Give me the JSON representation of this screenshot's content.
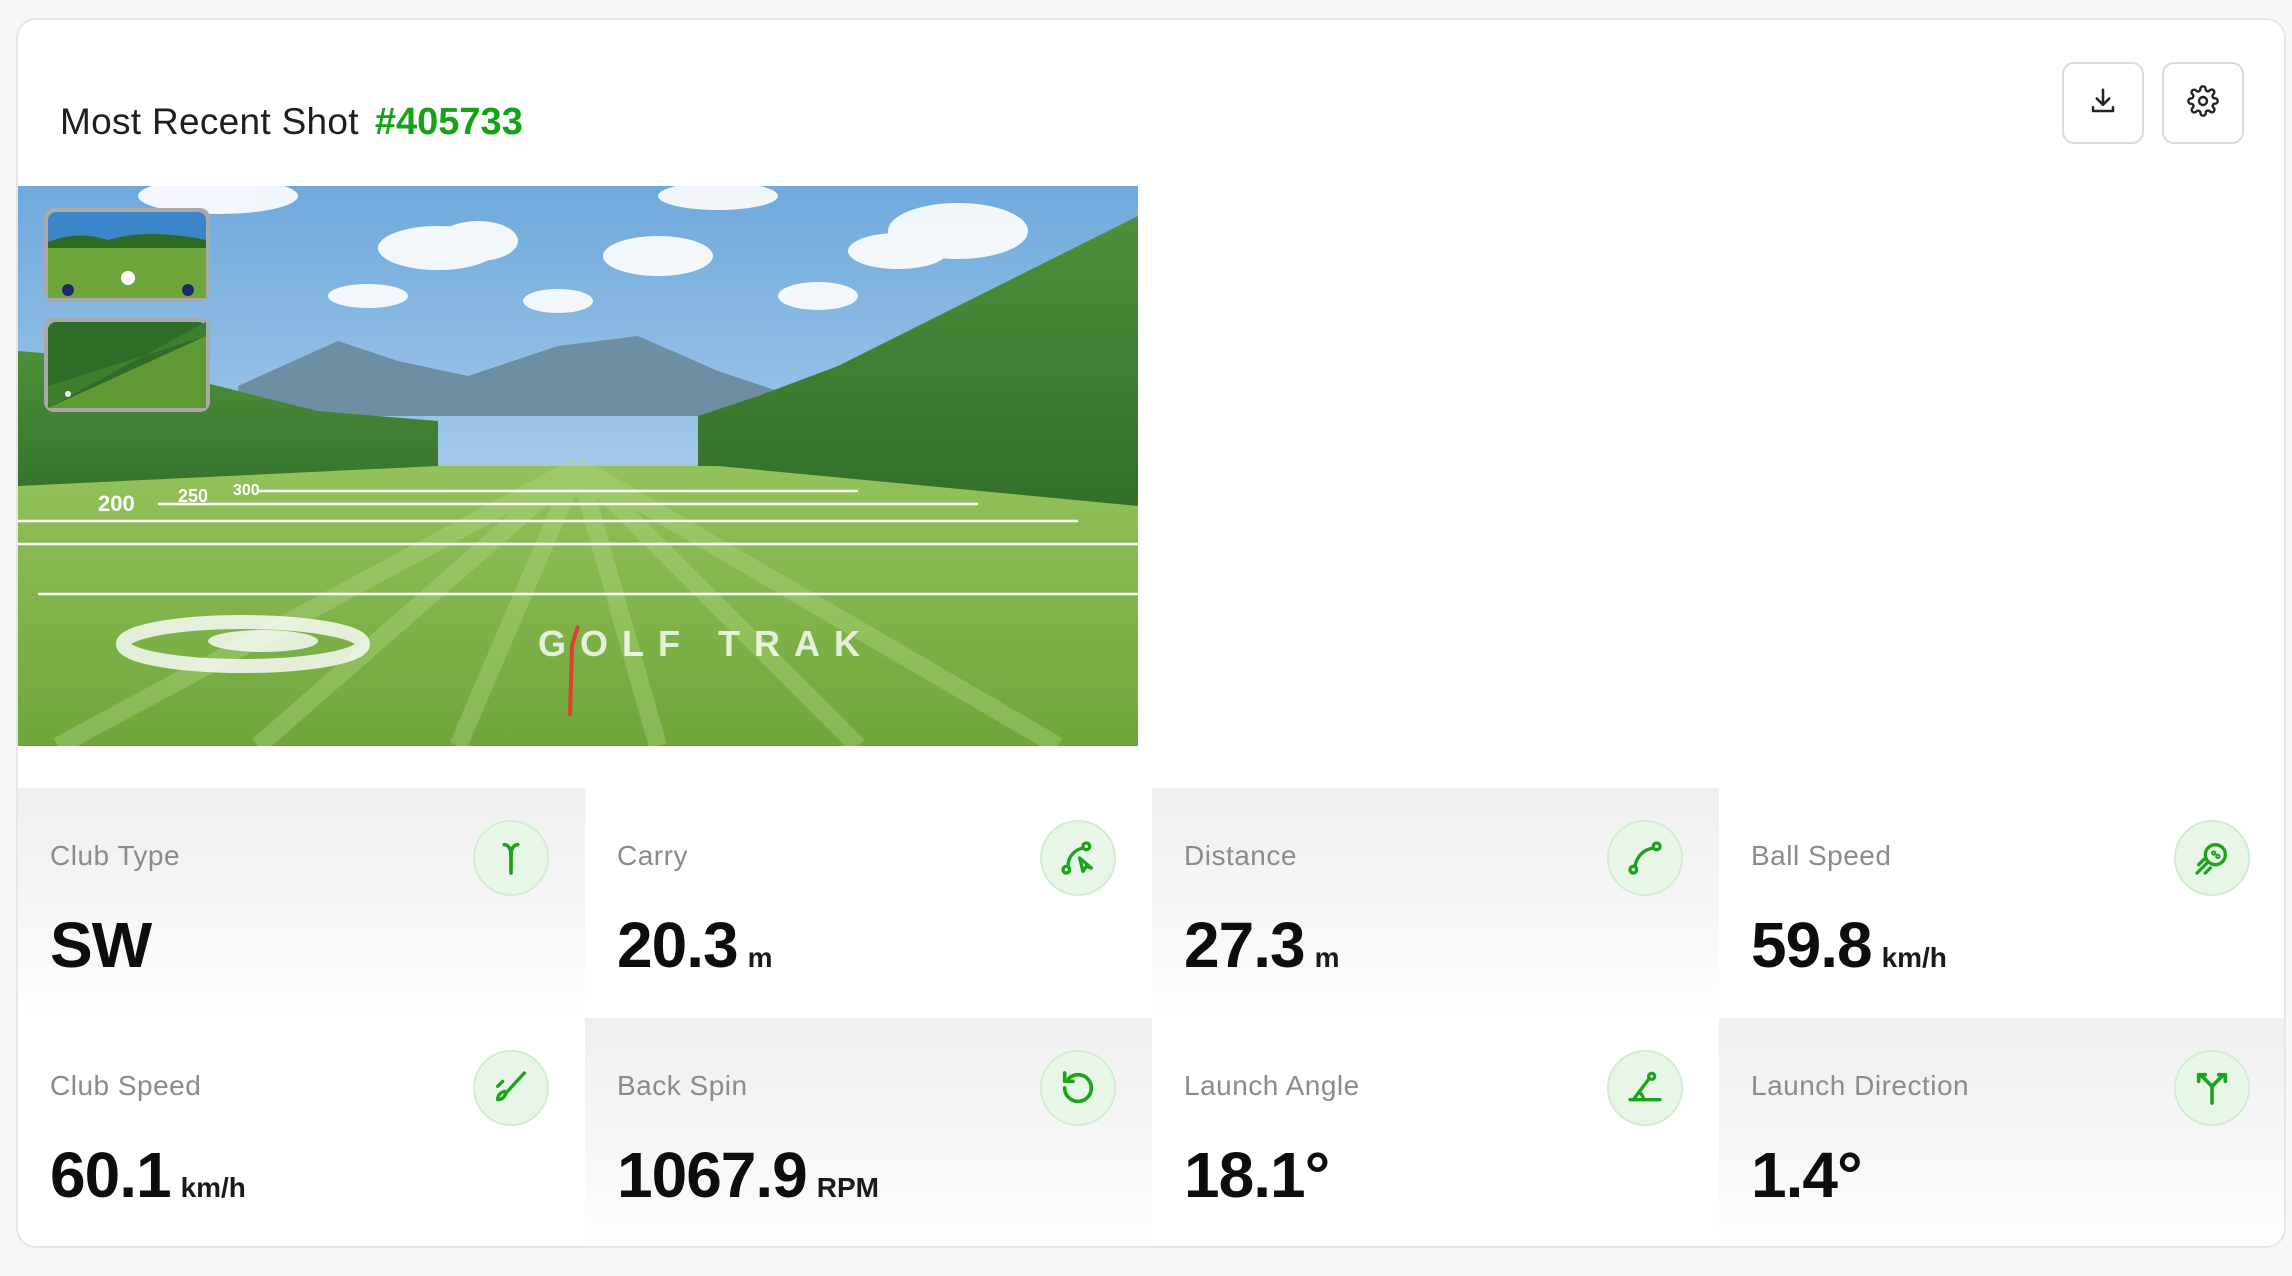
{
  "header": {
    "title": "Most Recent Shot",
    "shot_id": "#405733",
    "download_icon": "download-icon",
    "settings_icon": "gear-icon"
  },
  "scene": {
    "yard_markers": [
      "200",
      "250",
      "300"
    ],
    "brand_text": "GOLF TRAK"
  },
  "metrics": [
    {
      "label": "Club Type",
      "value": "SW",
      "unit": "",
      "icon": "club-icon"
    },
    {
      "label": "Carry",
      "value": "20.3",
      "unit": "m",
      "icon": "carry-arc-icon"
    },
    {
      "label": "Distance",
      "value": "27.3",
      "unit": "m",
      "icon": "distance-arc-icon"
    },
    {
      "label": "Ball Speed",
      "value": "59.8",
      "unit": "km/h",
      "icon": "ball-speed-icon"
    },
    {
      "label": "Club Speed",
      "value": "60.1",
      "unit": "km/h",
      "icon": "club-speed-icon"
    },
    {
      "label": "Back Spin",
      "value": "1067.9",
      "unit": "RPM",
      "icon": "rotate-icon"
    },
    {
      "label": "Launch Angle",
      "value": "18.1°",
      "unit": "",
      "icon": "angle-icon"
    },
    {
      "label": "Launch Direction",
      "value": "1.4°",
      "unit": "",
      "icon": "split-direction-icon"
    }
  ],
  "colors": {
    "accent": "#14a314",
    "icon_bg": "#e8f6e8"
  }
}
